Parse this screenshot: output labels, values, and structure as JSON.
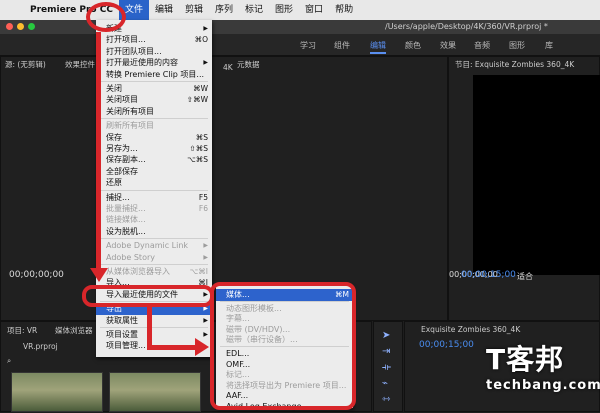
{
  "menubar": {
    "app_name": "Premiere Pro CC",
    "items": [
      "文件",
      "编辑",
      "剪辑",
      "序列",
      "标记",
      "图形",
      "窗口",
      "帮助"
    ]
  },
  "titlebar": {
    "path": "/Users/apple/Desktop/4K/360/VR.prproj *"
  },
  "workspaces": [
    "学习",
    "组件",
    "编辑",
    "颜色",
    "效果",
    "音频",
    "图形",
    "库"
  ],
  "source_panel": {
    "tabs": [
      "源: (无剪辑)",
      "效果控件",
      "元数据"
    ],
    "clip_label": "4K",
    "timecode_left": "00;00;00;00"
  },
  "program_panel": {
    "title": "节目: Exquisite Zombies 360_4K",
    "timecode": "00;00;15;00",
    "fit_label": "适合",
    "timecode_right": "00;00;00;00"
  },
  "project_panel": {
    "tabs": [
      "项目: VR",
      "媒体浏览器"
    ],
    "file": "VR.prproj"
  },
  "timeline_panel": {
    "title": "Exquisite Zombies 360_4K",
    "timecode": "00;00;15;00"
  },
  "file_menu": {
    "items": [
      {
        "label": "新建",
        "shortcut": "",
        "arrow": true,
        "disabled": false
      },
      {
        "label": "打开项目...",
        "shortcut": "⌘O",
        "arrow": false,
        "disabled": false
      },
      {
        "label": "打开团队项目...",
        "shortcut": "",
        "arrow": false,
        "disabled": false
      },
      {
        "label": "打开最近使用的内容",
        "shortcut": "",
        "arrow": true,
        "disabled": false
      },
      {
        "label": "转换 Premiere Clip 项目...",
        "shortcut": "",
        "arrow": false,
        "disabled": false
      },
      {
        "label": "关闭",
        "shortcut": "⌘W",
        "arrow": false,
        "disabled": false
      },
      {
        "label": "关闭项目",
        "shortcut": "⇧⌘W",
        "arrow": false,
        "disabled": false
      },
      {
        "label": "关闭所有项目",
        "shortcut": "",
        "arrow": false,
        "disabled": false
      },
      {
        "label": "刷新所有项目",
        "shortcut": "",
        "arrow": false,
        "disabled": true
      },
      {
        "label": "保存",
        "shortcut": "⌘S",
        "arrow": false,
        "disabled": false
      },
      {
        "label": "另存为...",
        "shortcut": "⇧⌘S",
        "arrow": false,
        "disabled": false
      },
      {
        "label": "保存副本...",
        "shortcut": "⌥⌘S",
        "arrow": false,
        "disabled": false
      },
      {
        "label": "全部保存",
        "shortcut": "",
        "arrow": false,
        "disabled": false
      },
      {
        "label": "还原",
        "shortcut": "",
        "arrow": false,
        "disabled": false
      },
      {
        "label": "捕捉...",
        "shortcut": "F5",
        "arrow": false,
        "disabled": false
      },
      {
        "label": "批量捕捉...",
        "shortcut": "F6",
        "arrow": false,
        "disabled": true
      },
      {
        "label": "链接媒体...",
        "shortcut": "",
        "arrow": false,
        "disabled": true
      },
      {
        "label": "设为脱机...",
        "shortcut": "",
        "arrow": false,
        "disabled": false
      },
      {
        "label": "Adobe Dynamic Link",
        "shortcut": "",
        "arrow": true,
        "disabled": true
      },
      {
        "label": "Adobe Story",
        "shortcut": "",
        "arrow": true,
        "disabled": true
      },
      {
        "label": "从媒体浏览器导入",
        "shortcut": "⌥⌘I",
        "arrow": false,
        "disabled": true
      },
      {
        "label": "导入...",
        "shortcut": "⌘I",
        "arrow": false,
        "disabled": false
      },
      {
        "label": "导入最近使用的文件",
        "shortcut": "",
        "arrow": true,
        "disabled": false
      },
      {
        "label": "导出",
        "shortcut": "",
        "arrow": true,
        "disabled": false,
        "highlight": true
      },
      {
        "label": "获取属性",
        "shortcut": "",
        "arrow": true,
        "disabled": false
      },
      {
        "label": "项目设置",
        "shortcut": "",
        "arrow": true,
        "disabled": false
      },
      {
        "label": "项目管理...",
        "shortcut": "",
        "arrow": false,
        "disabled": false
      }
    ]
  },
  "export_menu": {
    "items": [
      {
        "label": "媒体...",
        "shortcut": "⌘M",
        "disabled": false,
        "highlight": true
      },
      {
        "label": "动态图形模板...",
        "shortcut": "",
        "disabled": true
      },
      {
        "label": "字幕...",
        "shortcut": "",
        "disabled": true
      },
      {
        "label": "磁带 (DV/HDV)...",
        "shortcut": "",
        "disabled": true
      },
      {
        "label": "磁带（串行设备）...",
        "shortcut": "",
        "disabled": true
      },
      {
        "label": "EDL...",
        "shortcut": "",
        "disabled": false
      },
      {
        "label": "OMF...",
        "shortcut": "",
        "disabled": false
      },
      {
        "label": "标记...",
        "shortcut": "",
        "disabled": true
      },
      {
        "label": "将选择项导出为 Premiere 项目...",
        "shortcut": "",
        "disabled": true
      },
      {
        "label": "AAF...",
        "shortcut": "",
        "disabled": false
      },
      {
        "label": "Avid Log Exchange...",
        "shortcut": "",
        "disabled": false
      }
    ]
  },
  "watermark": {
    "cn": "T客邦",
    "en": "techbang.com"
  },
  "colors": {
    "accent": "#2d63cc",
    "annotation_red": "#d8262a",
    "timecode_blue": "#4a8df0"
  }
}
